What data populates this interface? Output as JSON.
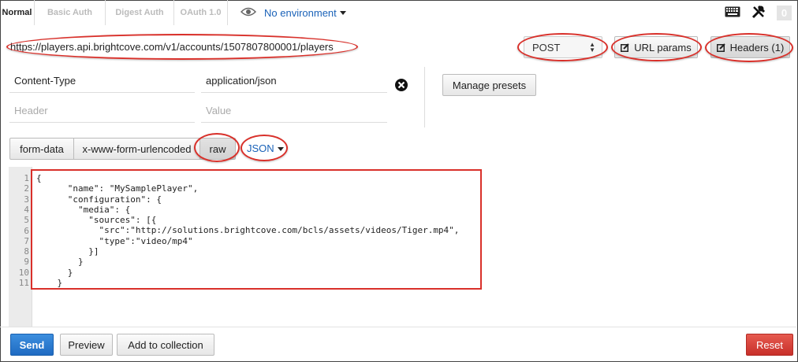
{
  "tabs": [
    {
      "label": "Normal",
      "active": true
    },
    {
      "label": "Basic Auth",
      "active": false
    },
    {
      "label": "Digest Auth",
      "active": false
    },
    {
      "label": "OAuth 1.0",
      "active": false
    }
  ],
  "environment": {
    "label": "No environment",
    "icon": "eye-icon"
  },
  "top_right": {
    "keyboard_icon": "keyboard-icon",
    "tools_icon": "tools-icon",
    "count": "0"
  },
  "request": {
    "url": "https://players.api.brightcove.com/v1/accounts/1507807800001/players",
    "method": "POST",
    "url_params_label": "URL params",
    "headers_label": "Headers (1)"
  },
  "headers": {
    "rows": [
      {
        "key": "Content-Type",
        "value": "application/json"
      }
    ],
    "key_placeholder": "Header",
    "value_placeholder": "Value",
    "manage_presets_label": "Manage presets"
  },
  "body_types": {
    "form_data": "form-data",
    "urlencoded": "x-www-form-urlencoded",
    "raw": "raw",
    "raw_format": "JSON"
  },
  "editor": {
    "line_numbers": [
      "1",
      "2",
      "3",
      "4",
      "5",
      "6",
      "7",
      "8",
      "9",
      "10",
      "11"
    ],
    "lines": [
      "{",
      "      \"name\": \"MySamplePlayer\",",
      "      \"configuration\": {",
      "        \"media\": {",
      "          \"sources\": [{",
      "            \"src\":\"http://solutions.brightcove.com/bcls/assets/videos/Tiger.mp4\",",
      "            \"type\":\"video/mp4\"",
      "          }]",
      "        }",
      "      }",
      "    }"
    ]
  },
  "actions": {
    "send": "Send",
    "preview": "Preview",
    "add_to_collection": "Add to collection",
    "reset": "Reset"
  },
  "colors": {
    "annotation": "#d9302a",
    "send": "#2a7bd3",
    "reset": "#d6403a",
    "link": "#1a62b8"
  }
}
